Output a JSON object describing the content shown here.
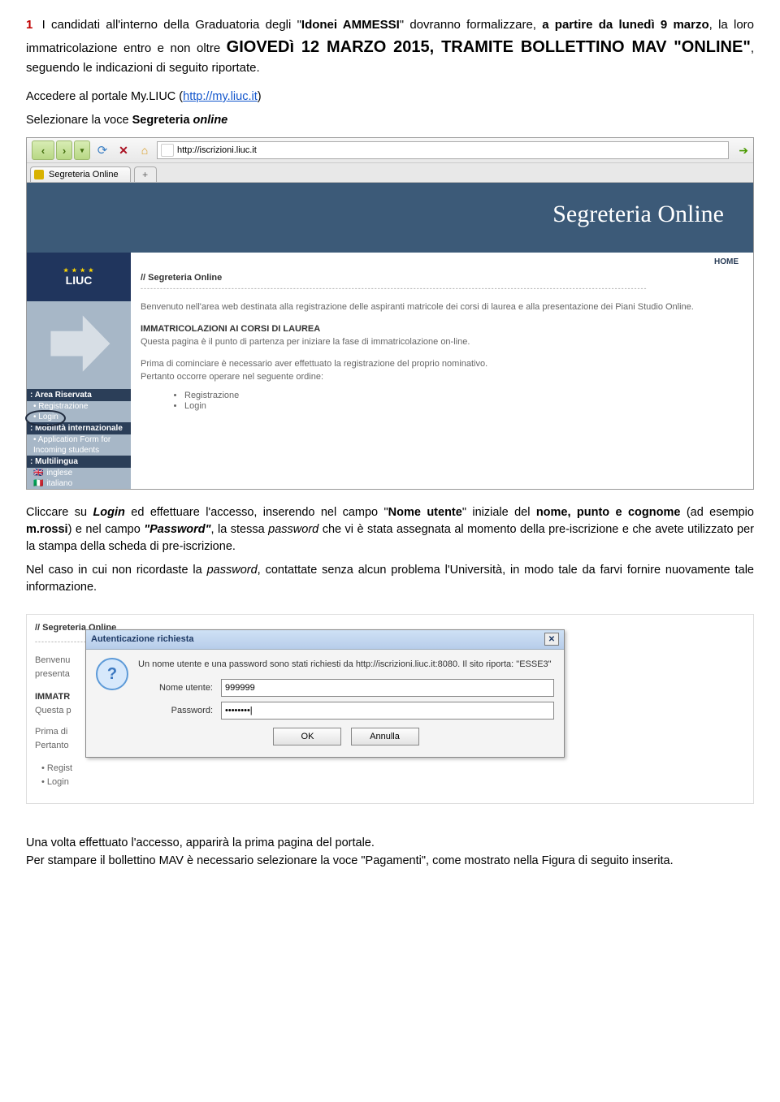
{
  "heading": {
    "num": "1",
    "pre": " I candidati all'interno della Graduatoria degli \"",
    "idonei": "Idonei AMMESSI",
    "mid": "\" dovranno formalizzare, ",
    "a_partire": "a partire da lunedì 9 marzo",
    "mid2": ", la loro immatricolazione entro e non oltre ",
    "big_date": "GIOVEDì 12 MARZO 2015,",
    "tramite": " TRAMITE BOLLETTINO MAV \"ONLINE\"",
    "tail": ", seguendo le indicazioni di seguito riportate."
  },
  "p_accedere_pre": "Accedere al portale My.LIUC (",
  "p_accedere_link": "http://my.liuc.it",
  "p_accedere_post": ")",
  "p_selezionare_pre": "Selezionare la voce ",
  "p_selezionare_bold": "Segreteria ",
  "p_selezionare_bi": "online",
  "browser": {
    "url": "http://iscrizioni.liuc.it",
    "tab_label": "Segreteria Online",
    "tab_add": "+"
  },
  "seg": {
    "title": "Segreteria Online",
    "liuc": "LIUC",
    "home_link": "HOME",
    "crumb": "// Segreteria Online",
    "dash": "------------------------------------------------------------------------------------------------------------------------------------------------------------",
    "welcome": "Benvenuto nell'area web destinata alla registrazione delle aspiranti matricole dei corsi di laurea e alla presentazione dei Piani Studio Online.",
    "immat_hd": "IMMATRICOLAZIONI AI CORSI DI LAUREA",
    "immat_txt": "Questa pagina è il punto di partenza per iniziare la fase di immatricolazione on-line.",
    "prima1": "Prima di cominciare è necessario aver effettuato la registrazione del proprio nominativo.",
    "prima2": "Pertanto occorre operare nel seguente ordine:",
    "li1": "Registrazione",
    "li2": "Login",
    "side": {
      "area_hd": ": Area Riservata",
      "reg": "Registrazione",
      "login": "Login",
      "mob_hd": ": Mobilità internazionale",
      "app1": "Application Form for",
      "app2": "Incoming students",
      "multi_hd": ": Multilingua",
      "en": "inglese",
      "it": "italiano"
    }
  },
  "p_login_pre": "Cliccare su ",
  "p_login_bi": "Login",
  "p_login_mid": " ed effettuare l'accesso, inserendo nel campo \"",
  "p_login_nome": "Nome utente",
  "p_login_mid2": "\" iniziale del ",
  "p_login_nome2": "nome, punto e cognome",
  "p_login_mid3": " (ad esempio ",
  "p_login_mrossi": "m.rossi",
  "p_login_mid4": ") e nel campo ",
  "p_login_pwd_q": "\"Password\"",
  "p_login_mid5": ", la stessa ",
  "p_login_pwd_i": "password",
  "p_login_tail": " che vi è stata assegnata al momento della pre-iscrizione e che avete utilizzato per la stampa della scheda di pre-iscrizione.",
  "p_caso_pre": "Nel caso in cui non ricordaste la ",
  "p_caso_pwd": "password",
  "p_caso_tail": ", contattate senza alcun problema l'Università, in modo tale da farvi fornire nuovamente tale informazione.",
  "snip": {
    "crumb": "// Segreteria Online",
    "benv_cut": "Benvenu",
    "pres_cut": "presenta",
    "immat_hd": "IMMATR",
    "questa_cut": "Questa p",
    "prima_cut": "Prima di",
    "pert_cut": "Pertanto",
    "li1": "Regist",
    "li2": "Login"
  },
  "dialog": {
    "title": "Autenticazione richiesta",
    "msg": "Un nome utente e una password sono stati richiesti da http://iscrizioni.liuc.it:8080. Il sito riporta: \"ESSE3\"",
    "user_label": "Nome utente:",
    "user_value": "999999",
    "pwd_label": "Password:",
    "pwd_value": "••••••••|",
    "ok": "OK",
    "cancel": "Annulla",
    "glyph": "?"
  },
  "final": {
    "l1": "Una volta effettuato l'accesso, apparirà la prima pagina del portale.",
    "l2_pre": "Per stampare il bollettino MAV è necessario selezionare la voce \"",
    "l2_bold": "Pagamenti",
    "l2_post": "\", come mostrato nella Figura di seguito inserita."
  }
}
